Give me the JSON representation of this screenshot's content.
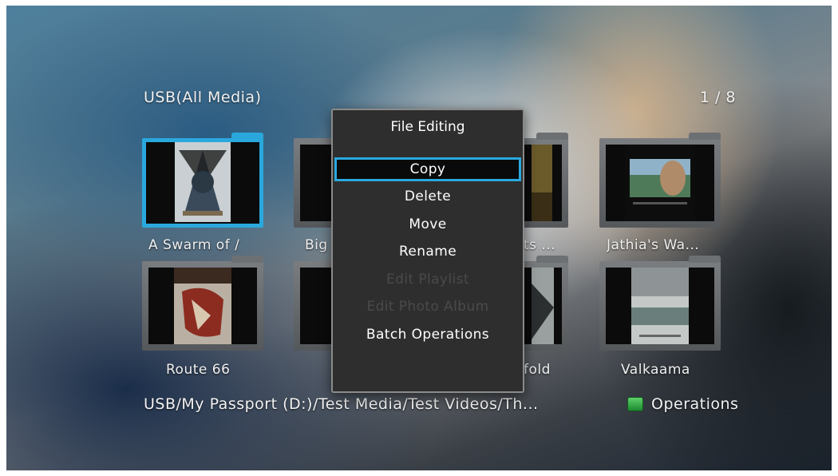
{
  "header": {
    "title": "USB(All Media)",
    "page": "1 / 8"
  },
  "tiles": [
    {
      "caption": "A Swarm of /",
      "selected": true
    },
    {
      "caption": "Big"
    },
    {
      "caption": "ts ..."
    },
    {
      "caption": "Jathia's Wa..."
    },
    {
      "caption": "Route 66"
    },
    {
      "caption": ""
    },
    {
      "caption": "fold"
    },
    {
      "caption": "Valkaama"
    }
  ],
  "footer": {
    "path": "USB/My Passport (D:)/Test Media/Test Videos/Th...",
    "operations_label": "Operations",
    "operations_key_color": "#2fb544"
  },
  "menu": {
    "title": "File Editing",
    "items": [
      {
        "label": "Copy",
        "enabled": true,
        "focused": true
      },
      {
        "label": "Delete",
        "enabled": true
      },
      {
        "label": "Move",
        "enabled": true
      },
      {
        "label": "Rename",
        "enabled": true
      },
      {
        "label": "Edit Playlist",
        "enabled": false
      },
      {
        "label": "Edit Photo Album",
        "enabled": false
      },
      {
        "label": "Batch Operations",
        "enabled": true
      }
    ]
  },
  "colors": {
    "accent": "#2aa8dd",
    "menu_bg": "#2e2e2e",
    "disabled_text": "#4a4a4a"
  }
}
